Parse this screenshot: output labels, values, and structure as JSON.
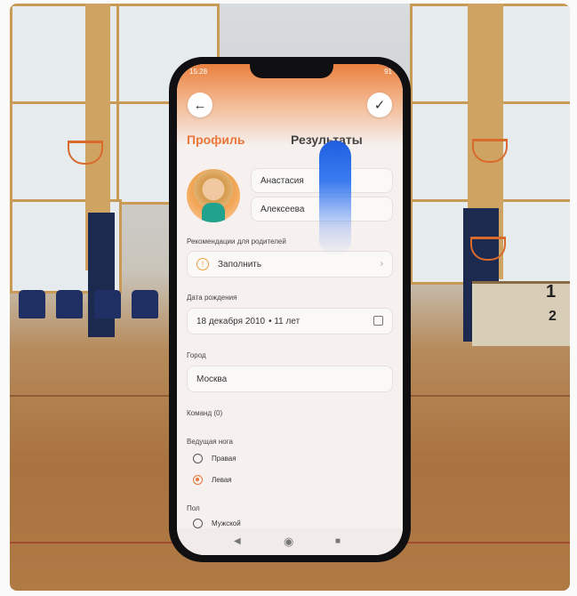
{
  "status": {
    "time": "15:28",
    "right": "91"
  },
  "header": {
    "back_icon": "arrow-left-icon",
    "confirm_icon": "check-icon"
  },
  "tabs": [
    {
      "label": "Профиль",
      "active": true
    },
    {
      "label": "Результаты",
      "active": false
    }
  ],
  "profile": {
    "first_name": "Анастасия",
    "last_name": "Алексеева"
  },
  "recommendations": {
    "label": "Рекомендации для родителей",
    "action": "Заполнить"
  },
  "birth": {
    "label": "Дата рождения",
    "value": "18 декабря 2010",
    "age": "• 11 лет"
  },
  "city": {
    "label": "Город",
    "value": "Москва"
  },
  "team": {
    "label": "Команд (0)"
  },
  "foot": {
    "label": "Ведущая нога",
    "options": [
      {
        "label": "Правая",
        "selected": false
      },
      {
        "label": "Левая",
        "selected": true
      }
    ]
  },
  "gender": {
    "label": "Пол",
    "options": [
      {
        "label": "Мужской",
        "selected": false
      }
    ]
  },
  "hall_numbers": [
    "1",
    "2"
  ],
  "colors": {
    "accent": "#e9773a",
    "screen_bg": "#f6f1ef"
  }
}
